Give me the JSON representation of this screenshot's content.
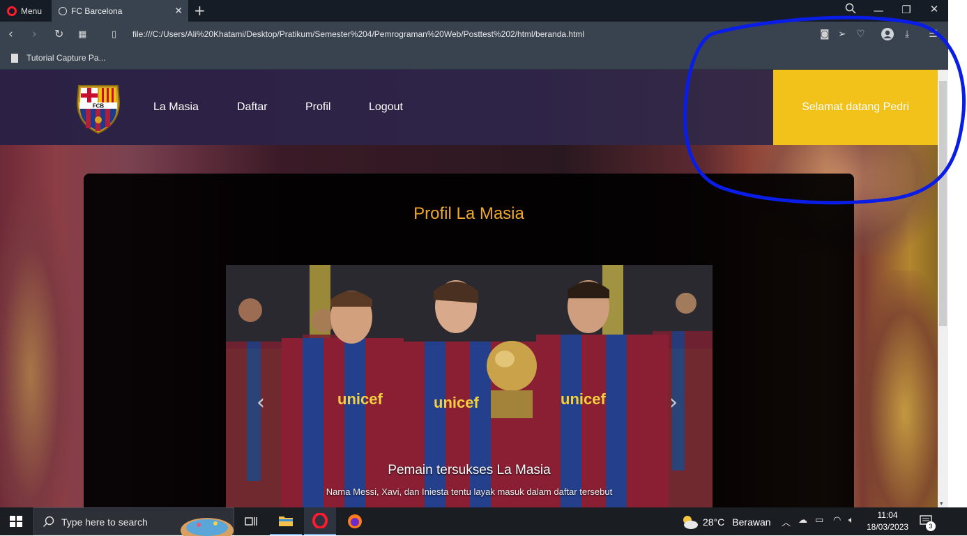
{
  "browser": {
    "menu_label": "Menu",
    "tab_title": "FC Barcelona",
    "tab_close": "✕",
    "new_tab": "+",
    "url": "file:///C:/Users/Ali%20Khatami/Desktop/Pratikum/Semester%204/Pemrograman%20Web/Posttest%202/html/beranda.html",
    "bookmark": "Tutorial Capture Pa..."
  },
  "site": {
    "nav": [
      "La Masia",
      "Daftar",
      "Profil",
      "Logout"
    ],
    "welcome": "Selamat datang Pedri",
    "logo_text": "FCB"
  },
  "card": {
    "title": "Profil La Masia",
    "slide_caption_title": "Pemain tersukses La Masia",
    "slide_caption_text": "Nama Messi, Xavi, dan Iniesta tentu layak masuk dalam daftar tersebut",
    "sponsor": "unicef",
    "prev_arrow": "‹",
    "next_arrow": "›"
  },
  "taskbar": {
    "search_placeholder": "Type here to search",
    "temperature": "28°C",
    "weather": "Berawan",
    "time": "11:04",
    "date": "18/03/2023",
    "notifications": "3"
  },
  "colors": {
    "header_bg": "#2c2145",
    "welcome_bg": "#f2c11a",
    "title_color": "#f0a82a",
    "annotation": "#0a1de6"
  }
}
